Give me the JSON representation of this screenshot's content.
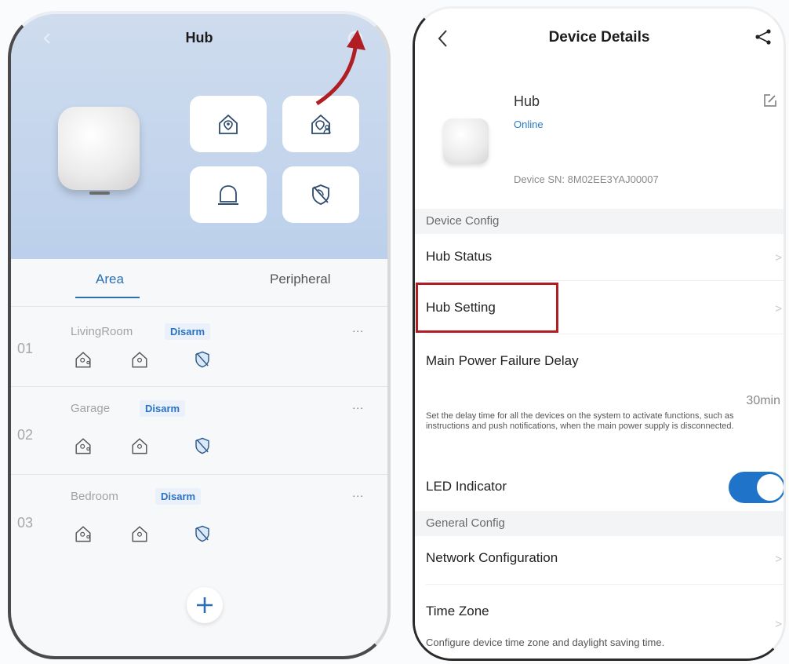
{
  "left": {
    "title": "Hub",
    "tabs": [
      {
        "label": "Area"
      },
      {
        "label": "Peripheral"
      }
    ],
    "areas": [
      {
        "num": "01",
        "name": "LivingRoom",
        "badge": "Disarm",
        "menu": "..."
      },
      {
        "num": "02",
        "name": "Garage",
        "badge": "Disarm",
        "menu": "..."
      },
      {
        "num": "03",
        "name": "Bedroom",
        "badge": "Disarm",
        "menu": "..."
      }
    ],
    "icons": {
      "arm_away": "home-shield-icon",
      "arm_stay": "home-person-icon",
      "sos": "alarm-bell-icon",
      "disarm": "shield-off-icon",
      "settings": "gear-icon",
      "add": "plus-icon"
    },
    "accent": "#2a6fb3",
    "arrow_color": "#b01e23"
  },
  "right": {
    "title": "Device Details",
    "device": {
      "name": "Hub",
      "status": "Online",
      "sn": "Device SN:  8M02EE3YAJ00007"
    },
    "sections": {
      "device_config": "Device Config",
      "general_config": "General Config"
    },
    "items": {
      "hub_status": "Hub Status",
      "hub_setting": "Hub Setting",
      "main_power": "Main Power Failure Delay",
      "main_power_value": "30min",
      "main_power_desc": "Set the delay time for all the devices on the system to activate functions, such as instructions and push notifications, when the main power supply is disconnected.",
      "led": "LED Indicator",
      "led_on": true,
      "network": "Network Configuration",
      "time_zone": "Time Zone",
      "time_zone_desc": "Configure device time zone and daylight saving time."
    },
    "chevron": ">",
    "toggle_color": "#1f73c8",
    "highlight_color": "#b01e23"
  }
}
